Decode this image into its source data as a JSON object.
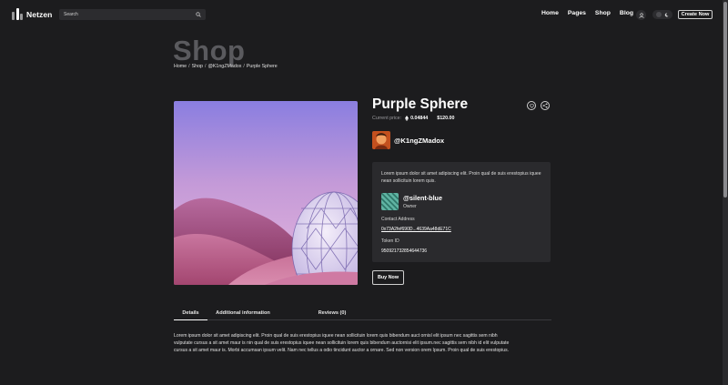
{
  "brand": {
    "name": "Netzen"
  },
  "search": {
    "placeholder": "Search"
  },
  "nav": {
    "items": [
      "Home",
      "Pages",
      "Shop",
      "Blog"
    ]
  },
  "header": {
    "create_label": "Create Now"
  },
  "hero": {
    "title": "Shop",
    "breadcrumb": [
      "Home",
      "Shop",
      "@K1ngZMadox",
      "Purple Sphere"
    ],
    "separator": "/"
  },
  "item": {
    "title": "Purple Sphere",
    "price_label": "Current price:",
    "price_eth": "0.04844",
    "price_usd": "$120.00",
    "owner_handle": "@K1ngZMadox",
    "description": "Lorem ipsum dolor sit amet adipiscing elit. Proin qual de suis erestopius iquee nean sollicituin lorem quis.",
    "creator_handle": "@silent-blue",
    "creator_role": "Owner",
    "contact_label": "Contact Address",
    "contact_value": "0x73A2fef690D...4639Aa48dE71C",
    "token_label": "Token ID",
    "token_value": "950921732854644736",
    "buy_label": "Buy Now"
  },
  "tabs": [
    "Details",
    "Additional information",
    "Reviews (0)"
  ],
  "details_text": "Lorem ipsum dolor sit amet adipiscing elit. Proin qual de suis erestopius iquee nean sollicituin lorem quis bibendum auct ornisl elit ipsum nec sagittis sem nibh vulputate cursus a sit amet maur is nin qual de suis erestopius iquee nean sollicituin lorem quis bibendum auctornisi elit ipsum.nec sagittis sem nibh id elit vulputate cursus a sit amet maur is. Morbi accumsan ipsum velit. Nam nec tellus a odio tincidunt auctor a ornare. Sed non version orem Ipsum. Proin qual de suis erestopius.",
  "icons": {
    "search": "search-icon",
    "user": "user-icon",
    "sun": "sun-icon",
    "moon": "moon-icon",
    "favorite": "heart-icon",
    "share": "share-icon",
    "ethereum": "ethereum-icon"
  }
}
